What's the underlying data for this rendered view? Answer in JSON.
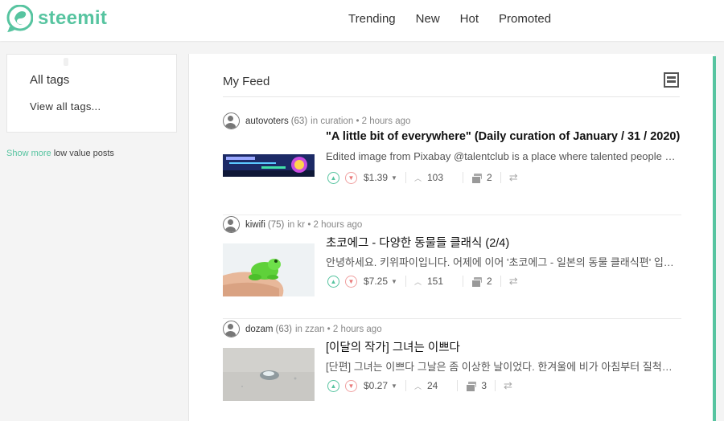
{
  "brand": {
    "name": "steemit",
    "accent": "#57c4a0"
  },
  "nav": {
    "items": [
      "Trending",
      "New",
      "Hot",
      "Promoted"
    ]
  },
  "sidebar": {
    "card_title": "All tags",
    "view_all": "View all tags...",
    "show_more": "Show more",
    "low_value": " low value posts"
  },
  "feed": {
    "title": "My Feed",
    "posts": [
      {
        "author": "autovoters",
        "rep": "(63)",
        "in_label": "in",
        "category": "curation",
        "time": "• 2 hours ago",
        "title": "\"A little bit of everywhere\" (Daily curation of January / 31 / 2020)",
        "body": "Edited image from Pixabay @talentclub is a place where talented people can showcase their work",
        "payout": "$1.39",
        "votes": "103",
        "comments": "2",
        "thumb": "autovoters-banner"
      },
      {
        "author": "kiwifi",
        "rep": "(75)",
        "in_label": "in",
        "category": "kr",
        "time": "• 2 hours ago",
        "title": "초코에그 - 다양한 동물들 클래식 (2/4)",
        "body": "안녕하세요. 키위파이입니다. 어제에 이어 '초코에그 - 일본의 동물 클래식편' 입니다",
        "payout": "$7.25",
        "votes": "151",
        "comments": "2",
        "thumb": "green-frog"
      },
      {
        "author": "dozam",
        "rep": "(63)",
        "in_label": "in",
        "category": "zzan",
        "time": "• 2 hours ago",
        "title": "[이달의 작가] 그녀는 이쁘다",
        "body": "[단편] 그녀는 이쁘다 그날은 좀 이상한 날이었다. 한겨울에 비가 아침부터 질척하게 내렸다",
        "payout": "$0.27",
        "votes": "24",
        "comments": "3",
        "thumb": "water-droplet"
      }
    ]
  }
}
